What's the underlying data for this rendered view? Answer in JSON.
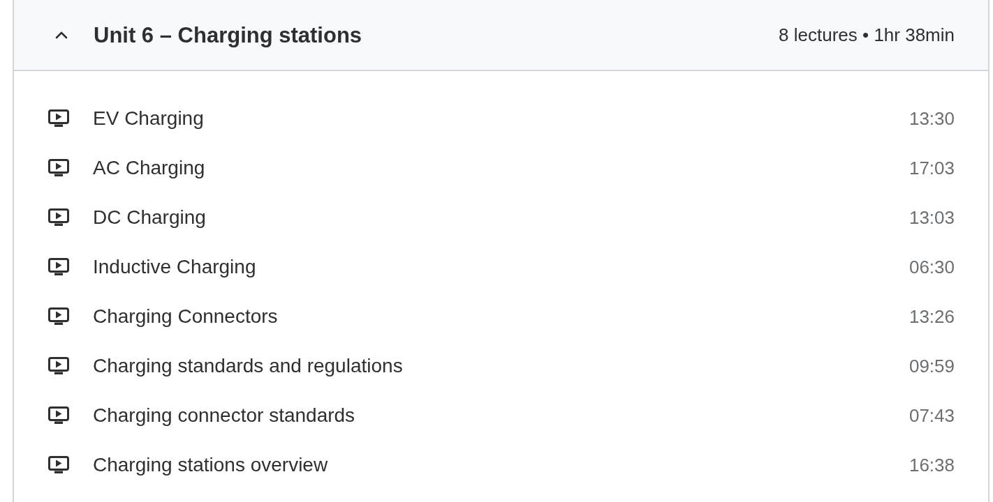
{
  "section": {
    "title": "Unit 6 – Charging stations",
    "expanded": true,
    "summary": "8 lectures • 1hr 38min"
  },
  "lectures": [
    {
      "title": "EV Charging",
      "duration": "13:30"
    },
    {
      "title": "AC Charging",
      "duration": "17:03"
    },
    {
      "title": "DC Charging",
      "duration": "13:03"
    },
    {
      "title": "Inductive Charging",
      "duration": "06:30"
    },
    {
      "title": "Charging Connectors",
      "duration": "13:26"
    },
    {
      "title": "Charging standards and regulations",
      "duration": "09:59"
    },
    {
      "title": "Charging connector standards",
      "duration": "07:43"
    },
    {
      "title": "Charging stations overview",
      "duration": "16:38"
    }
  ]
}
